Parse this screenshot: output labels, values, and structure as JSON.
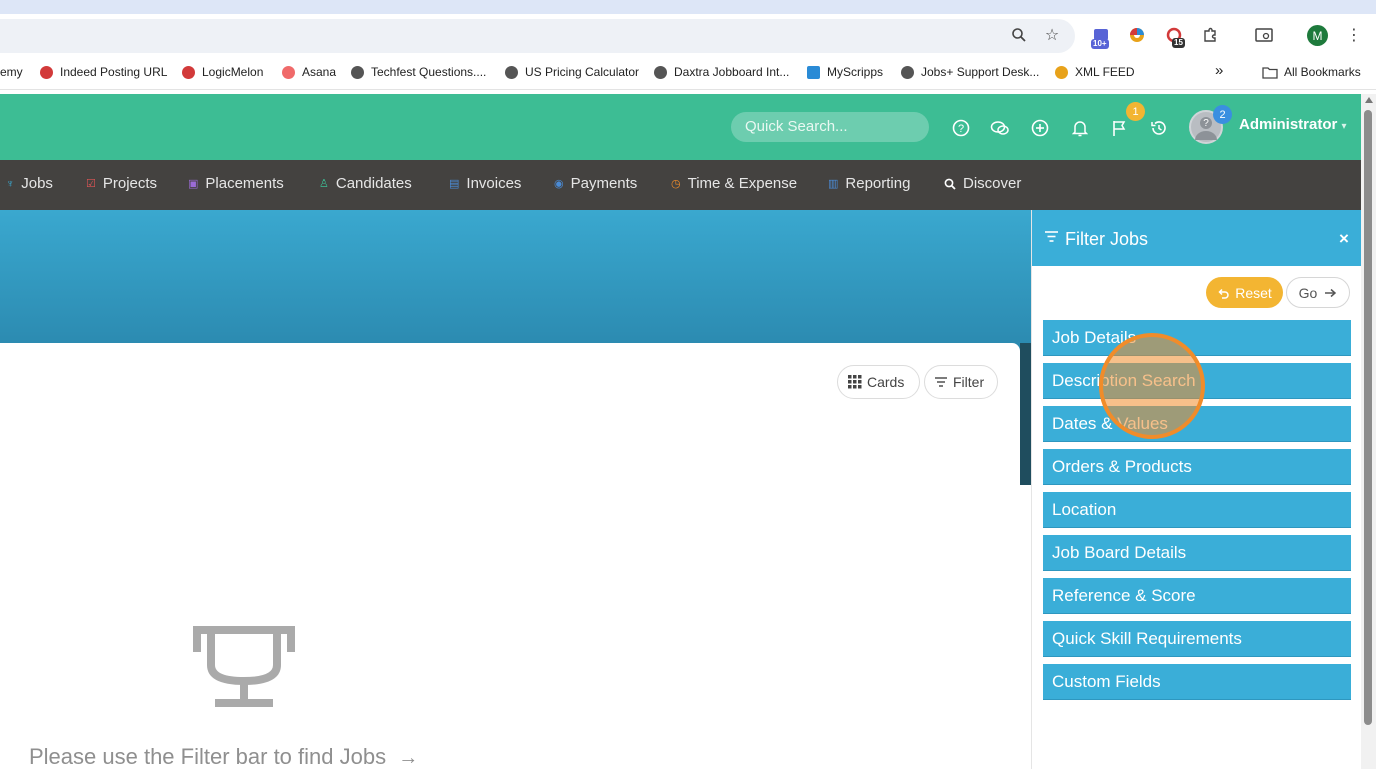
{
  "browser": {
    "bookmarks": [
      {
        "label": "emy",
        "color": "#ffffff"
      },
      {
        "label": "Indeed Posting URL",
        "color": "#d23a3a"
      },
      {
        "label": "LogicMelon",
        "color": "#d23a3a"
      },
      {
        "label": "Asana",
        "color": "#f06a6a"
      },
      {
        "label": "Techfest Questions....",
        "color": "#555555"
      },
      {
        "label": "US Pricing Calculator",
        "color": "#555555"
      },
      {
        "label": "Daxtra Jobboard Int...",
        "color": "#555555"
      },
      {
        "label": "MyScripps",
        "color": "#2a8bd6"
      },
      {
        "label": "Jobs+ Support Desk...",
        "color": "#555555"
      },
      {
        "label": "XML FEED",
        "color": "#e8a21a"
      }
    ],
    "more_bookmarks": "»",
    "all_bookmarks": "All Bookmarks",
    "extension_badges": {
      "first": "10+",
      "second": "15"
    },
    "profile_initial": "M"
  },
  "header": {
    "search_placeholder": "Quick Search...",
    "flag_badge": "1",
    "avatar_badge": "2",
    "user_name": "Administrator",
    "user_caret": "▾"
  },
  "nav": {
    "items": [
      {
        "label": "Jobs",
        "icon": "trophy-icon",
        "color": "#3aaed8"
      },
      {
        "label": "Projects",
        "icon": "check-icon",
        "color": "#e05555"
      },
      {
        "label": "Placements",
        "icon": "briefcase-icon",
        "color": "#9b6bd6"
      },
      {
        "label": "Candidates",
        "icon": "people-icon",
        "color": "#3dbd94"
      },
      {
        "label": "Invoices",
        "icon": "document-icon",
        "color": "#4a8bd6"
      },
      {
        "label": "Payments",
        "icon": "coins-icon",
        "color": "#4a8bd6"
      },
      {
        "label": "Time & Expense",
        "icon": "clock-icon",
        "color": "#f08c2a"
      },
      {
        "label": "Reporting",
        "icon": "chart-icon",
        "color": "#4a8bd6"
      },
      {
        "label": "Discover",
        "icon": "search-icon",
        "color": "#ffffff"
      }
    ]
  },
  "main": {
    "cards_label": "Cards",
    "filter_label": "Filter",
    "empty_message": "Please use the Filter bar to find Jobs",
    "empty_arrow": "→"
  },
  "filter_panel": {
    "title": "Filter Jobs",
    "close": "×",
    "reset_label": "Reset",
    "go_label": "Go",
    "sections": [
      "Job Details",
      "Description Search",
      "Dates & Values",
      "Orders & Products",
      "Location",
      "Job Board Details",
      "Reference & Score",
      "Quick Skill Requirements",
      "Custom Fields"
    ]
  }
}
